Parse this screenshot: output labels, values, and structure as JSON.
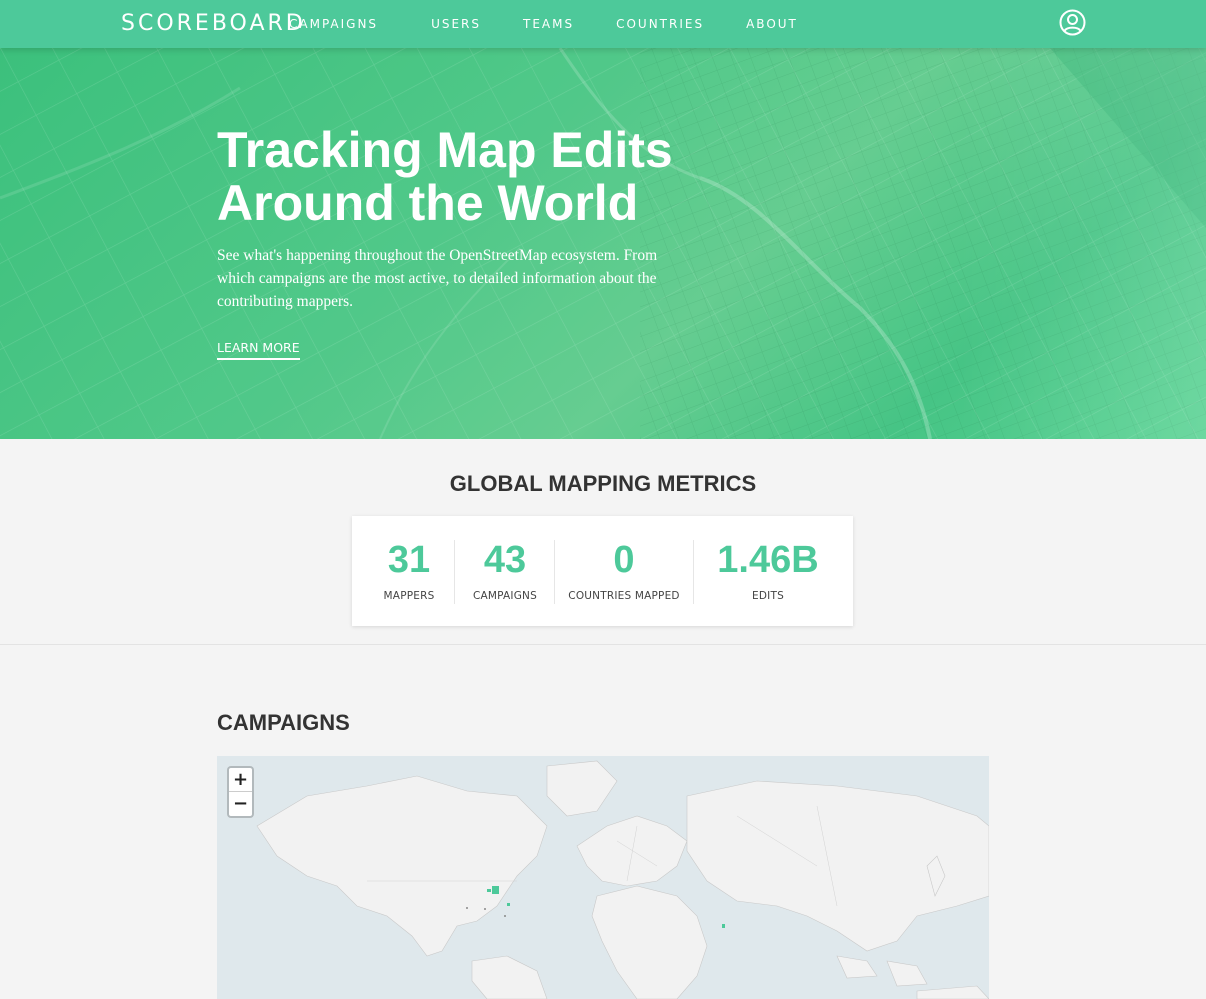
{
  "navbar": {
    "brand": "SCOREBOARD",
    "links": [
      "CAMPAIGNS",
      "USERS",
      "TEAMS",
      "COUNTRIES",
      "ABOUT"
    ],
    "account_icon": "user-circle-icon"
  },
  "hero": {
    "title_line1": "Tracking Map Edits",
    "title_line2": "Around the World",
    "description": "See what's happening throughout the OpenStreetMap ecosystem. From which campaigns are the most active, to detailed information about the contributing mappers.",
    "cta": "LEARN MORE"
  },
  "metrics": {
    "heading": "GLOBAL MAPPING METRICS",
    "items": [
      {
        "value": "31",
        "label": "MAPPERS"
      },
      {
        "value": "43",
        "label": "CAMPAIGNS"
      },
      {
        "value": "0",
        "label": "COUNTRIES MAPPED"
      },
      {
        "value": "1.46B",
        "label": "EDITS"
      }
    ]
  },
  "campaigns": {
    "heading": "CAMPAIGNS",
    "zoom_in": "+",
    "zoom_out": "−"
  },
  "colors": {
    "accent": "#4dc99a",
    "text_dark": "#333333",
    "page_bg": "#f4f4f4",
    "map_water": "#dfe8ec",
    "map_land": "#f2f2f2"
  }
}
